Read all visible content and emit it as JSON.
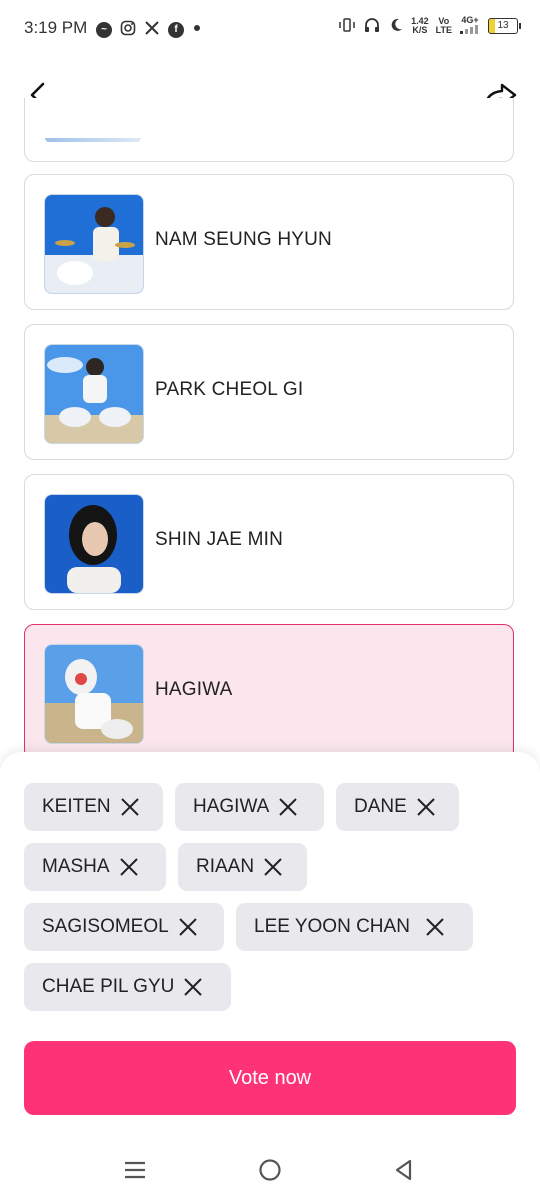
{
  "status_bar": {
    "time": "3:19 PM",
    "app_icons": [
      "messenger-icon",
      "instagram-icon",
      "x-icon",
      "facebook-icon",
      "dot-icon"
    ],
    "speed_value": "1.42",
    "speed_unit": "K/S",
    "volte_top": "Vo",
    "volte_bottom": "LTE",
    "network": "4G+",
    "battery": "13"
  },
  "header": {
    "back_icon": "chevron-left-icon",
    "share_icon": "share-arrow-icon"
  },
  "candidates": [
    {
      "name": "NAM SEUNG HYUN",
      "selected": false
    },
    {
      "name": "PARK CHEOL GI",
      "selected": false
    },
    {
      "name": "SHIN JAE MIN",
      "selected": false
    },
    {
      "name": "HAGIWA",
      "selected": true
    }
  ],
  "selected_chips": [
    "KEITEN",
    "HAGIWA",
    "DANE",
    "MASHA",
    "RIAAN",
    "SAGISOMEOL",
    "LEE YOON CHAN",
    "CHAE PIL GYU"
  ],
  "vote_button": {
    "label": "Vote now"
  },
  "colors": {
    "accent": "#fe3276",
    "selected_bg": "#fbe6ee",
    "selected_border": "#e0326e",
    "chip_bg": "#e9e9ed"
  },
  "nav_bar": [
    "menu-icon",
    "home-circle-icon",
    "back-triangle-icon"
  ]
}
